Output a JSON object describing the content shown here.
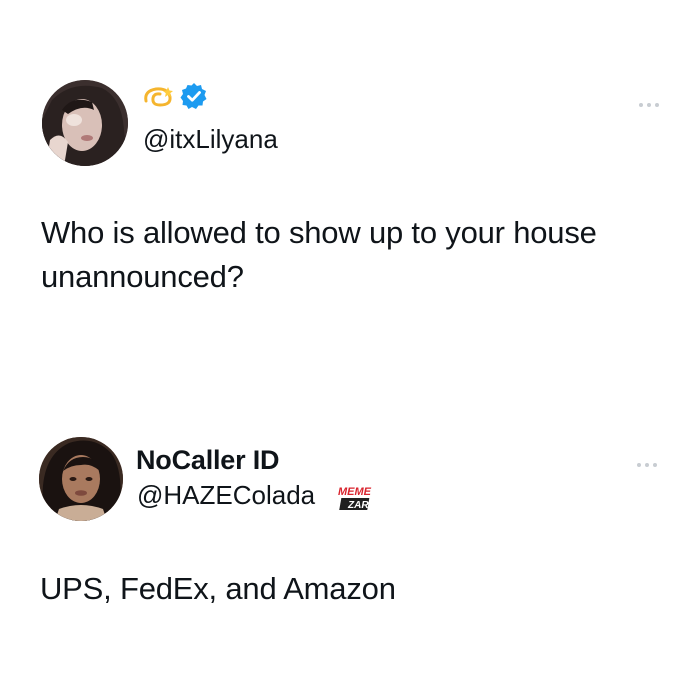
{
  "posts": [
    {
      "handle": "@itxLilyana",
      "verified": true,
      "name_emojis": [
        "dizzy-emoji"
      ],
      "text": "Who is allowed to show up to your house unannounced?",
      "more_icon": "ellipsis-icon"
    },
    {
      "display_name": "NoCaller ID",
      "handle": "@HAZEColada",
      "text": "UPS, FedEx, and Amazon",
      "more_icon": "ellipsis-icon",
      "watermark": {
        "line1": "MEME",
        "line2": "ZAR"
      }
    }
  ],
  "colors": {
    "text": "#0f1419",
    "verified_badge": "#1d9bf0",
    "more_dots": "#c8cdd2",
    "watermark_red": "#d9232d"
  }
}
